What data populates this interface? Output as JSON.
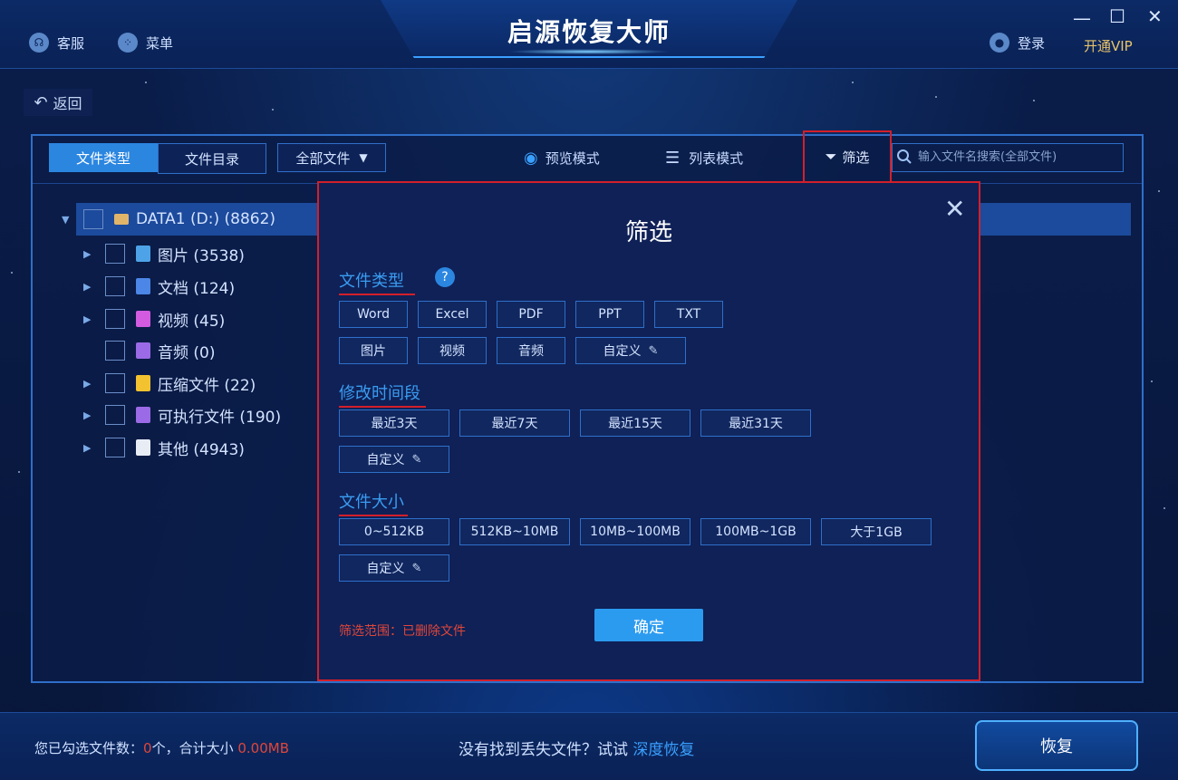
{
  "window": {
    "title": "启源恢复大师",
    "vip_label": "开通VIP",
    "login_label": "登录",
    "service_label": "客服",
    "menu_label": "菜单"
  },
  "nav": {
    "back_label": "返回"
  },
  "toolbar": {
    "tab_type": "文件类型",
    "tab_dir": "文件目录",
    "dropdown_value": "全部文件",
    "preview_mode": "预览模式",
    "list_mode": "列表模式",
    "filter_label": "筛选",
    "search_placeholder": "输入文件名搜索(全部文件)"
  },
  "tree": {
    "root": "DATA1 (D:) (8862)",
    "items": [
      {
        "label": "图片 (3538)",
        "color": "#4ea3e8",
        "expandable": true
      },
      {
        "label": "文档 (124)",
        "color": "#4c86e6",
        "expandable": true
      },
      {
        "label": "视频 (45)",
        "color": "#d35be0",
        "expandable": true
      },
      {
        "label": "音频 (0)",
        "color": "#9b6ae6",
        "expandable": false
      },
      {
        "label": "压缩文件 (22)",
        "color": "#f2c230",
        "expandable": true
      },
      {
        "label": "可执行文件 (190)",
        "color": "#9b6ae6",
        "expandable": true
      },
      {
        "label": "其他 (4943)",
        "color": "#e8ecf5",
        "expandable": true
      }
    ]
  },
  "filter_dialog": {
    "title": "筛选",
    "file_type": {
      "title": "文件类型",
      "help": "?",
      "row1": [
        "Word",
        "Excel",
        "PDF",
        "PPT",
        "TXT"
      ],
      "row2": [
        "图片",
        "视频",
        "音频"
      ],
      "custom": "自定义"
    },
    "time": {
      "title": "修改时间段",
      "options": [
        "最近3天",
        "最近7天",
        "最近15天",
        "最近31天"
      ],
      "custom": "自定义"
    },
    "size": {
      "title": "文件大小",
      "options": [
        "0~512KB",
        "512KB~10MB",
        "10MB~100MB",
        "100MB~1GB",
        "大于1GB"
      ],
      "custom": "自定义"
    },
    "scope": "筛选范围：已删除文件",
    "confirm": "确定"
  },
  "bottom": {
    "selected_prefix": "您已勾选文件数：",
    "selected_count": "0",
    "selected_mid": "个，合计大小",
    "selected_size": "0.00MB",
    "tip_text": "没有找到丢失文件？试试",
    "tip_link": "深度恢复",
    "recover_label": "恢复"
  }
}
